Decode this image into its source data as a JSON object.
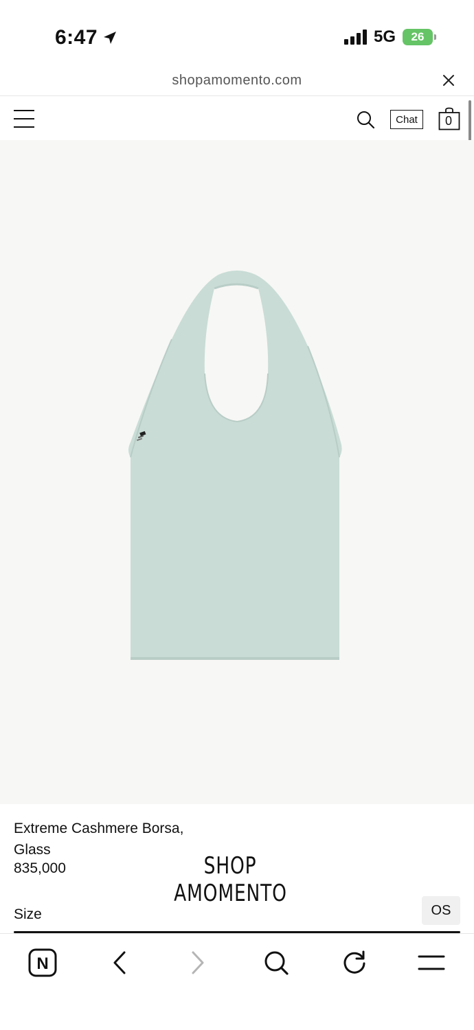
{
  "status_bar": {
    "time": "6:47",
    "network": "5G",
    "battery": "26"
  },
  "browser": {
    "url": "shopamomento.com"
  },
  "header": {
    "chat_label": "Chat",
    "cart_count": "0"
  },
  "product": {
    "name": "Extreme Cashmere Borsa, Glass",
    "price": "835,000",
    "size_label": "Size",
    "size_option": "OS",
    "image_color": "#c9dcd6"
  },
  "brand": {
    "line1": "SHOP",
    "line2": "AMOMENTO"
  },
  "toolbar": {
    "home_letter": "N"
  },
  "icons": [
    "location-arrow-icon",
    "signal-icon",
    "battery-icon",
    "close-icon",
    "menu-icon",
    "search-icon",
    "cart-icon",
    "back-icon",
    "forward-icon",
    "reload-icon"
  ]
}
